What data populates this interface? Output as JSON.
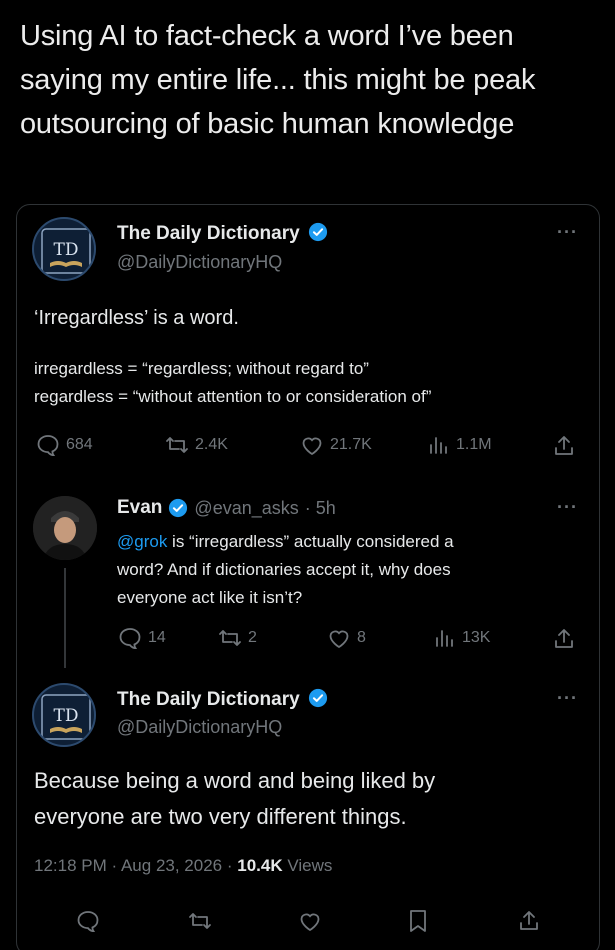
{
  "caption": "Using AI to fact-check a word I’ve been saying my entire life... this might be peak outsourcing of basic human knowledge",
  "post1": {
    "name": "The Daily Dictionary",
    "handle": "@DailyDictionaryHQ",
    "more": "···",
    "text": "‘Irregardless’ is a word.",
    "def1": "irregardless = “regardless; without regard to”",
    "def2": "regardless = “without attention to or consideration of”",
    "stats": {
      "replies": "684",
      "reposts": "2.4K",
      "likes": "21.7K",
      "views": "1.1M"
    }
  },
  "reply": {
    "name": "Evan",
    "handle": "@evan_asks",
    "time": "· 5h",
    "more": "···",
    "mention": "@grok",
    "text_after_mention": " is “irregardless” actually considered a",
    "line2": "word? And if dictionaries accept it, why does",
    "line3": "everyone act like it isn’t?",
    "stats": {
      "replies": "14",
      "reposts": "2",
      "likes": "8",
      "views": "13K"
    }
  },
  "post2": {
    "name": "The Daily Dictionary",
    "handle": "@DailyDictionaryHQ",
    "more": "···",
    "line1": "Because being a word and being liked by",
    "line2": "everyone are two very different things.",
    "time": "12:18 PM",
    "date": "Aug 23, 2026",
    "views_count": "10.4K",
    "views_label": "Views",
    "dot": "·"
  },
  "avatar_monogram": "TD",
  "colors": {
    "background": "#000000",
    "text": "#e7e9ea",
    "muted": "#71767b",
    "accent": "#1d9bf0",
    "border": "#2f3336"
  },
  "icons": [
    "verified-badge-icon",
    "reply-icon",
    "repost-icon",
    "like-icon",
    "views-icon",
    "share-icon",
    "bookmark-icon",
    "more-icon"
  ]
}
